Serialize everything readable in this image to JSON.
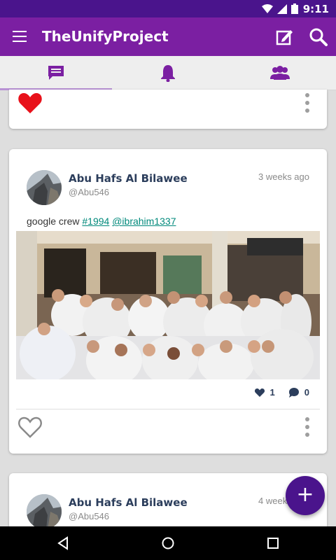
{
  "status_bar": {
    "time": "9:11"
  },
  "app_bar": {
    "title": "TheUnifyProject"
  },
  "tabs": [
    {
      "name": "messages-icon",
      "selected": true
    },
    {
      "name": "bell-icon",
      "selected": false
    },
    {
      "name": "people-icon",
      "selected": false
    }
  ],
  "posts": [
    {
      "user": "Abu Hafs Al Bilawee",
      "handle": "@Abu546",
      "time": "3 weeks ago",
      "text": "google crew",
      "hashtag": "#1994",
      "mention": "@ibrahim1337",
      "likes": "1",
      "comments": "0"
    },
    {
      "user": "Abu Hafs Al Bilawee",
      "handle": "@Abu546",
      "time": "4 weeks ago"
    }
  ],
  "fab": {
    "label": "+"
  },
  "colors": {
    "primary": "#7b1fa2",
    "primary_dark": "#4a148c",
    "like_red": "#e8111a",
    "link": "#00897b"
  }
}
